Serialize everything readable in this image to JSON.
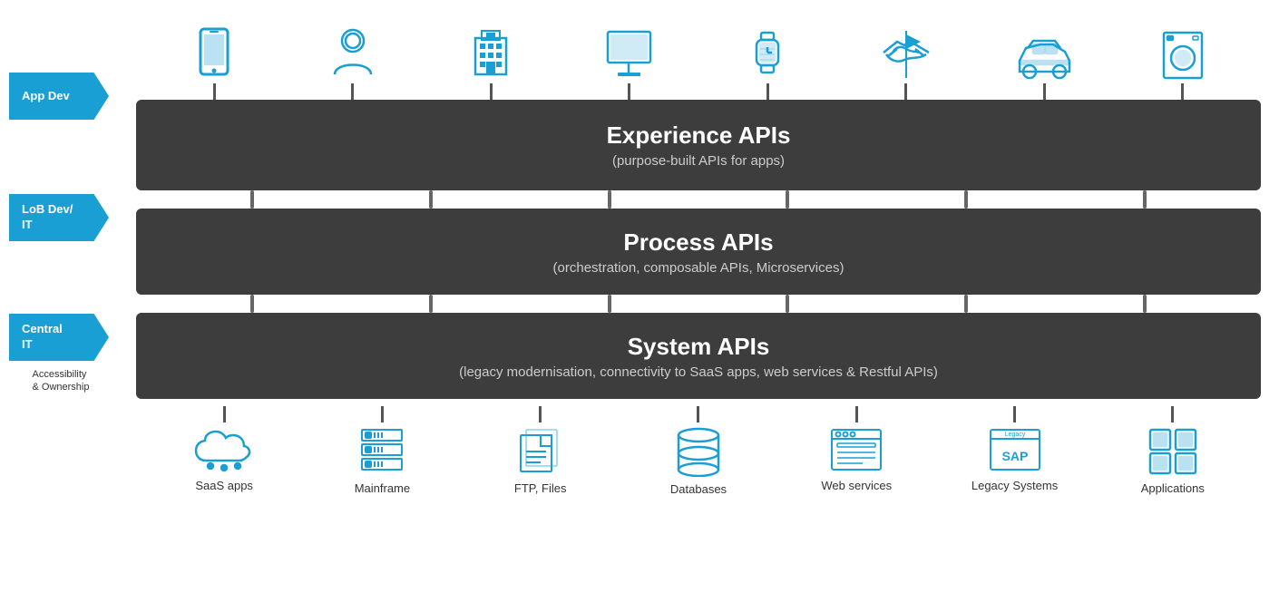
{
  "chevrons": [
    {
      "id": "app-dev",
      "label": "App Dev"
    },
    {
      "id": "lob-dev",
      "label": "LoB Dev/\nIT"
    },
    {
      "id": "central-it",
      "label": "Central\nIT"
    }
  ],
  "accessibility_label": "Accessibility\n& Ownership",
  "api_layers": [
    {
      "id": "experience",
      "title": "Experience APIs",
      "subtitle": "(purpose-built APIs for apps)"
    },
    {
      "id": "process",
      "title": "Process APIs",
      "subtitle": "(orchestration, composable APIs, Microservices)"
    },
    {
      "id": "system",
      "title": "System APIs",
      "subtitle": "(legacy modernisation, connectivity to SaaS apps, web services & Restful APIs)"
    }
  ],
  "top_icons": [
    {
      "id": "mobile",
      "label": "mobile"
    },
    {
      "id": "user",
      "label": "user"
    },
    {
      "id": "building",
      "label": "building"
    },
    {
      "id": "desktop",
      "label": "desktop"
    },
    {
      "id": "watch",
      "label": "watch"
    },
    {
      "id": "handshake",
      "label": "handshake"
    },
    {
      "id": "car",
      "label": "car"
    },
    {
      "id": "appliance",
      "label": "appliance"
    }
  ],
  "bottom_icons": [
    {
      "id": "saas",
      "label": "SaaS apps"
    },
    {
      "id": "mainframe",
      "label": "Mainframe"
    },
    {
      "id": "ftp",
      "label": "FTP, Files"
    },
    {
      "id": "databases",
      "label": "Databases"
    },
    {
      "id": "webservices",
      "label": "Web services"
    },
    {
      "id": "legacy",
      "label": "Legacy Systems"
    },
    {
      "id": "applications",
      "label": "Applications"
    }
  ],
  "colors": {
    "blue": "#1a9fd4",
    "dark_bg": "#3d3d3d",
    "text_light": "#ffffff",
    "text_sub": "#cccccc",
    "connector": "#555555"
  }
}
